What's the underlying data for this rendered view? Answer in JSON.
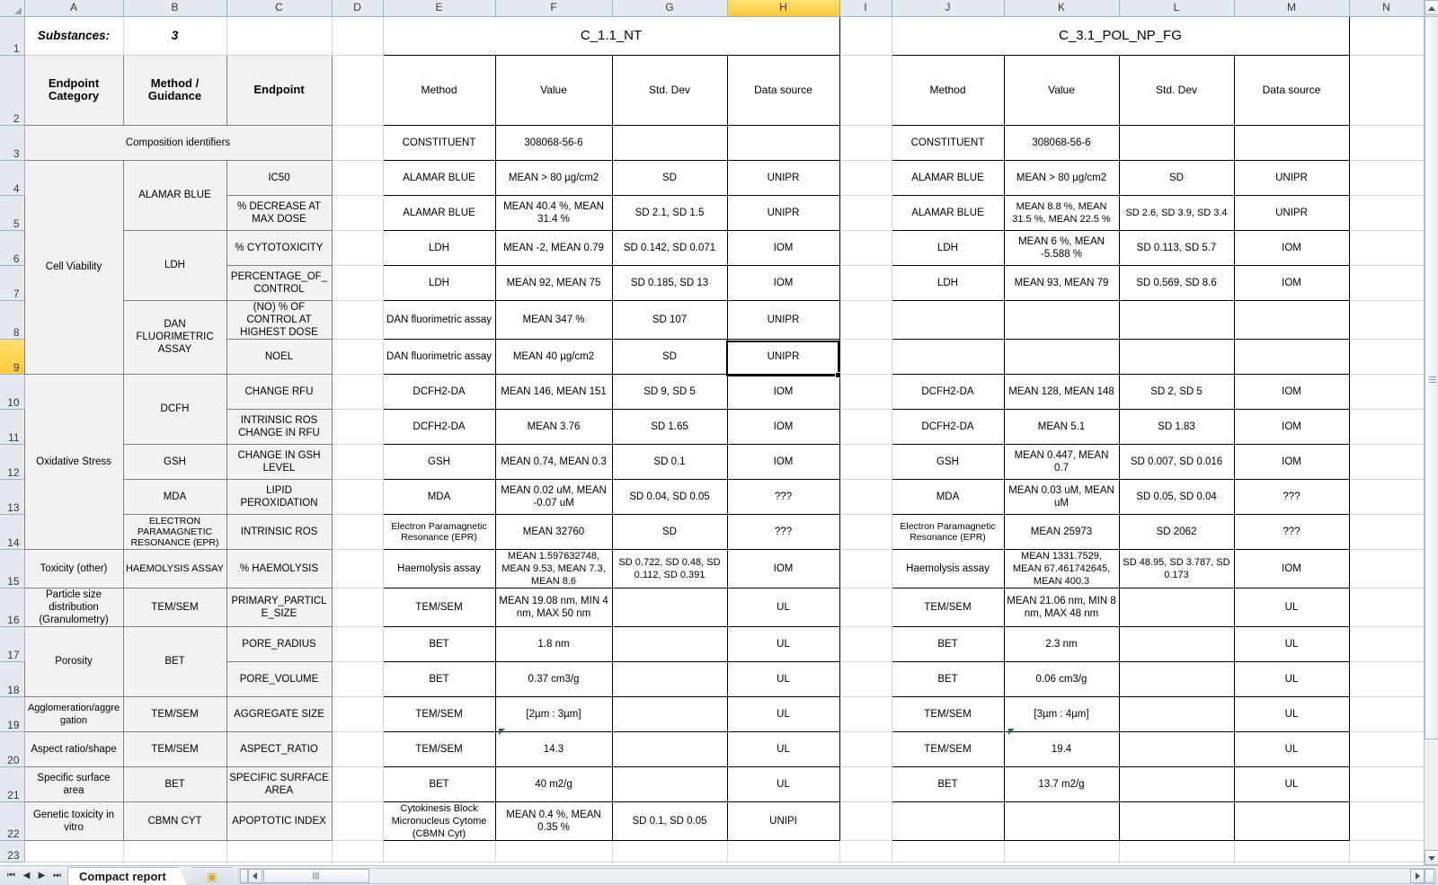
{
  "app": {
    "column_headers": [
      "A",
      "B",
      "C",
      "D",
      "E",
      "F",
      "G",
      "H",
      "I",
      "J",
      "K",
      "L",
      "M",
      "N"
    ],
    "active_column": "H",
    "active_row": "9",
    "row_numbers": [
      "1",
      "2",
      "3",
      "4",
      "5",
      "6",
      "7",
      "8",
      "9",
      "10",
      "11",
      "12",
      "13",
      "14",
      "15",
      "16",
      "17",
      "18",
      "19",
      "20",
      "21",
      "22",
      "23"
    ],
    "sheet_tab": "Compact report",
    "new_sheet_icon": "new-sheet-icon",
    "nav_first_icon": "⏮",
    "nav_prev_icon": "◀",
    "nav_next_icon": "▶",
    "nav_last_icon": "⏭"
  },
  "header": {
    "substances_label": "Substances:",
    "substances_count": "3",
    "endpoint_category": "Endpoint Category",
    "method_guidance": "Method / Guidance",
    "endpoint": "Endpoint",
    "composition_identifiers": "Composition identifiers",
    "group1_title": "C_1.1_NT",
    "group2_title": "C_3.1_POL_NP_FG",
    "sub_headers": {
      "method": "Method",
      "value": "Value",
      "std_dev": "Std. Dev",
      "data_source": "Data source"
    }
  },
  "rows": [
    {
      "row": "3",
      "category": "",
      "method_guidance": "",
      "endpoint": "",
      "g1": {
        "method": "CONSTITUENT",
        "value": "308068-56-6",
        "sd": "",
        "src": ""
      },
      "g2": {
        "method": "CONSTITUENT",
        "value": "308068-56-6",
        "sd": "",
        "src": ""
      }
    },
    {
      "row": "4",
      "category": "Cell Viability",
      "method_guidance": "ALAMAR BLUE",
      "endpoint": "IC50",
      "g1": {
        "method": "ALAMAR BLUE",
        "value": "MEAN > 80 µg/cm2",
        "sd": "SD",
        "src": "UNIPR"
      },
      "g2": {
        "method": "ALAMAR BLUE",
        "value": "MEAN > 80 µg/cm2",
        "sd": "SD",
        "src": "UNIPR"
      }
    },
    {
      "row": "5",
      "category": "",
      "method_guidance": "",
      "endpoint": "% DECREASE AT MAX DOSE",
      "g1": {
        "method": "ALAMAR BLUE",
        "value": "MEAN 40.4 %, MEAN 31.4 %",
        "sd": "SD 2.1, SD 1.5",
        "src": "UNIPR"
      },
      "g2": {
        "method": "ALAMAR BLUE",
        "value": "MEAN 8.8 %, MEAN 31.5 %, MEAN 22.5 %",
        "sd": "SD 2.6, SD 3.9, SD 3.4",
        "src": "UNIPR"
      }
    },
    {
      "row": "6",
      "category": "",
      "method_guidance": "LDH",
      "endpoint": "% CYTOTOXICITY",
      "g1": {
        "method": "LDH",
        "value": "MEAN -2, MEAN 0.79",
        "sd": "SD 0.142, SD 0.071",
        "src": "IOM"
      },
      "g2": {
        "method": "LDH",
        "value": "MEAN 6 %, MEAN -5.588 %",
        "sd": "SD 0.113, SD 5.7",
        "src": "IOM"
      }
    },
    {
      "row": "7",
      "category": "",
      "method_guidance": "",
      "endpoint": "PERCENTAGE_OF_CONTROL",
      "g1": {
        "method": "LDH",
        "value": "MEAN 92, MEAN 75",
        "sd": "SD 0.185, SD 13",
        "src": "IOM"
      },
      "g2": {
        "method": "LDH",
        "value": "MEAN 93, MEAN 79",
        "sd": "SD 0.569, SD 8.6",
        "src": "IOM"
      }
    },
    {
      "row": "8",
      "category": "",
      "method_guidance": "DAN FLUORIMETRIC ASSAY",
      "endpoint": "(NO) % OF CONTROL AT HIGHEST DOSE",
      "g1": {
        "method": "DAN fluorimetric assay",
        "value": "MEAN 347 %",
        "sd": "SD 107",
        "src": "UNIPR"
      },
      "g2": {
        "method": "",
        "value": "",
        "sd": "",
        "src": ""
      }
    },
    {
      "row": "9",
      "category": "",
      "method_guidance": "",
      "endpoint": "NOEL",
      "g1": {
        "method": "DAN fluorimetric assay",
        "value": "MEAN 40 µg/cm2",
        "sd": "SD",
        "src": "UNIPR"
      },
      "g2": {
        "method": "",
        "value": "",
        "sd": "",
        "src": ""
      }
    },
    {
      "row": "10",
      "category": "Oxidative Stress",
      "method_guidance": "DCFH",
      "endpoint": "CHANGE RFU",
      "g1": {
        "method": "DCFH2-DA",
        "value": "MEAN 146, MEAN 151",
        "sd": "SD 9, SD 5",
        "src": "IOM"
      },
      "g2": {
        "method": "DCFH2-DA",
        "value": "MEAN 128, MEAN 148",
        "sd": "SD 2, SD 5",
        "src": "IOM"
      }
    },
    {
      "row": "11",
      "category": "",
      "method_guidance": "",
      "endpoint": "INTRINSIC ROS CHANGE IN RFU",
      "g1": {
        "method": "DCFH2-DA",
        "value": "MEAN 3.76",
        "sd": "SD 1.65",
        "src": "IOM"
      },
      "g2": {
        "method": "DCFH2-DA",
        "value": "MEAN 5.1",
        "sd": "SD 1.83",
        "src": "IOM"
      }
    },
    {
      "row": "12",
      "category": "",
      "method_guidance": "GSH",
      "endpoint": "CHANGE IN GSH LEVEL",
      "g1": {
        "method": "GSH",
        "value": "MEAN 0.74, MEAN 0.3",
        "sd": "SD 0.1",
        "src": "IOM"
      },
      "g2": {
        "method": "GSH",
        "value": "MEAN 0.447, MEAN 0.7",
        "sd": "SD 0.007, SD 0.016",
        "src": "IOM"
      }
    },
    {
      "row": "13",
      "category": "",
      "method_guidance": "MDA",
      "endpoint": "LIPID PEROXIDATION",
      "g1": {
        "method": "MDA",
        "value": "MEAN 0.02 uM, MEAN -0.07 uM",
        "sd": "SD 0.04, SD 0.05",
        "src": "???"
      },
      "g2": {
        "method": "MDA",
        "value": "MEAN 0.03 uM, MEAN uM",
        "sd": "SD 0.05, SD 0.04",
        "src": "???"
      }
    },
    {
      "row": "14",
      "category": "",
      "method_guidance": "ELECTRON PARAMAGNETIC RESONANCE (EPR)",
      "endpoint": "INTRINSIC ROS",
      "g1": {
        "method": "Electron Paramagnetic Resonance (EPR)",
        "value": "MEAN 32760",
        "sd": "SD",
        "src": "???"
      },
      "g2": {
        "method": "Electron Paramagnetic Resonance (EPR)",
        "value": "MEAN 25973",
        "sd": "SD 2062",
        "src": "???"
      }
    },
    {
      "row": "15",
      "category": "Toxicity (other)",
      "method_guidance": "HAEMOLYSIS ASSAY",
      "endpoint": "% HAEMOLYSIS",
      "g1": {
        "method": "Haemolysis assay",
        "value": "MEAN 1.597632748, MEAN 9.53, MEAN 7.3, MEAN 8.6",
        "sd": "SD 0.722, SD 0.48, SD 0.112, SD 0.391",
        "src": "IOM"
      },
      "g2": {
        "method": "Haemolysis assay",
        "value": "MEAN 1331.7529, MEAN 67.461742645, MEAN 400.3",
        "sd": "SD 48.95, SD 3.787, SD 0.173",
        "src": "IOM"
      }
    },
    {
      "row": "16",
      "category": "Particle size distribution (Granulometry)",
      "method_guidance": "TEM/SEM",
      "endpoint": "PRIMARY_PARTICLE_SIZE",
      "g1": {
        "method": "TEM/SEM",
        "value": "MEAN 19.08 nm, MIN 4 nm, MAX 50 nm",
        "sd": "",
        "src": "UL"
      },
      "g2": {
        "method": "TEM/SEM",
        "value": "MEAN 21.06 nm, MIN 8 nm, MAX 48 nm",
        "sd": "",
        "src": "UL"
      }
    },
    {
      "row": "17",
      "category": "Porosity",
      "method_guidance": "BET",
      "endpoint": "PORE_RADIUS",
      "g1": {
        "method": "BET",
        "value": "1.8 nm",
        "sd": "",
        "src": "UL"
      },
      "g2": {
        "method": "BET",
        "value": "2.3 nm",
        "sd": "",
        "src": "UL"
      }
    },
    {
      "row": "18",
      "category": "",
      "method_guidance": "",
      "endpoint": "PORE_VOLUME",
      "g1": {
        "method": "BET",
        "value": "0.37 cm3/g",
        "sd": "",
        "src": "UL"
      },
      "g2": {
        "method": "BET",
        "value": "0.06 cm3/g",
        "sd": "",
        "src": "UL"
      }
    },
    {
      "row": "19",
      "category": "Agglomeration/aggregation",
      "method_guidance": "TEM/SEM",
      "endpoint": "AGGREGATE SIZE",
      "g1": {
        "method": "TEM/SEM",
        "value": "[2µm : 3µm]",
        "sd": "",
        "src": "UL"
      },
      "g2": {
        "method": "TEM/SEM",
        "value": "[3µm : 4µm]",
        "sd": "",
        "src": "UL"
      }
    },
    {
      "row": "20",
      "category": "Aspect ratio/shape",
      "method_guidance": "TEM/SEM",
      "endpoint": "ASPECT_RATIO",
      "g1": {
        "method": "TEM/SEM",
        "value": "14.3",
        "sd": "",
        "src": "UL"
      },
      "g2": {
        "method": "TEM/SEM",
        "value": "19.4",
        "sd": "",
        "src": "UL"
      }
    },
    {
      "row": "21",
      "category": "Specific surface area",
      "method_guidance": "BET",
      "endpoint": "SPECIFIC SURFACE AREA",
      "g1": {
        "method": "BET",
        "value": "40 m2/g",
        "sd": "",
        "src": "UL"
      },
      "g2": {
        "method": "BET",
        "value": "13.7 m2/g",
        "sd": "",
        "src": "UL"
      }
    },
    {
      "row": "22",
      "category": "Genetic toxicity in vitro",
      "method_guidance": "CBMN CYT",
      "endpoint": "APOPTOTIC INDEX",
      "g1": {
        "method": "Cytokinesis Block Micronucleus Cytome (CBMN Cyt)",
        "value": "MEAN 0.4 %, MEAN 0.35 %",
        "sd": "SD 0.1, SD 0.05",
        "src": "UNIPI"
      },
      "g2": {
        "method": "",
        "value": "",
        "sd": "",
        "src": ""
      }
    }
  ]
}
